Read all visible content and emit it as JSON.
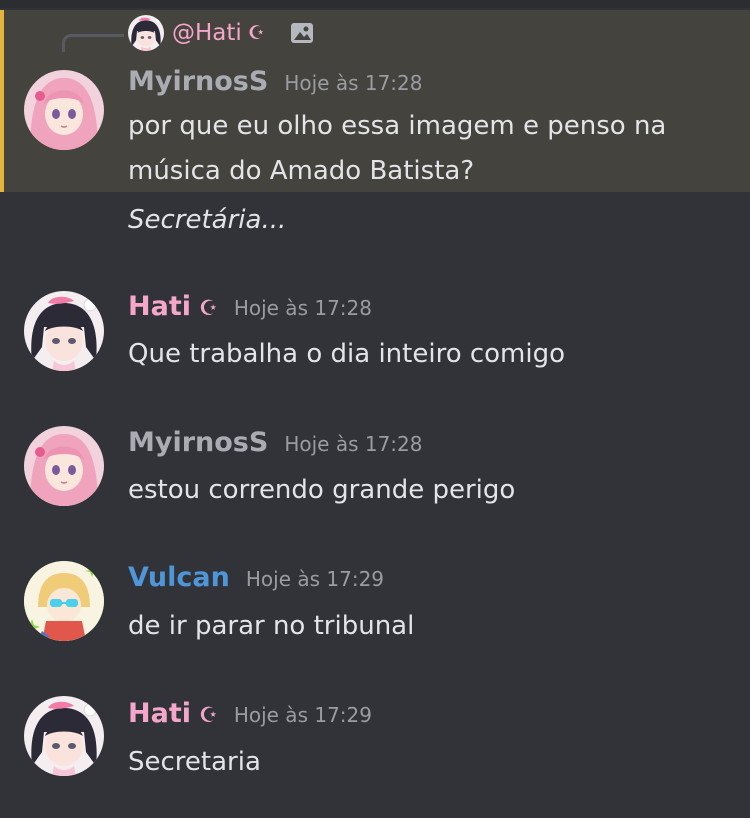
{
  "reply": {
    "username": "@Hati",
    "moon_icon": "☪",
    "attachment_icon": "image-icon"
  },
  "messages": [
    {
      "author": "MyirnosS",
      "timestamp": "Hoje às 17:28",
      "lines": [
        "por que eu olho essa imagem e penso na",
        "música do Amado Batista?",
        "Secretária..."
      ]
    },
    {
      "author": "Hati",
      "moon_icon": "☪",
      "timestamp": "Hoje às 17:28",
      "lines": [
        "Que trabalha o dia inteiro comigo"
      ]
    },
    {
      "author": "MyirnosS",
      "timestamp": "Hoje às 17:28",
      "lines": [
        "estou correndo grande perigo"
      ]
    },
    {
      "author": "Vulcan",
      "timestamp": "Hoje às 17:29",
      "lines": [
        "de ir parar no tribunal"
      ]
    },
    {
      "author": "Hati",
      "moon_icon": "☪",
      "timestamp": "Hoje às 17:29",
      "lines": [
        "Secretaria"
      ]
    }
  ],
  "colors": {
    "background": "#313338",
    "highlight": "#44433d",
    "highlight_bar": "#e4b53c",
    "myirnos_name": "#a9acb2",
    "hati_name": "#f4a6cb",
    "vulcan_name": "#4f96d8"
  }
}
